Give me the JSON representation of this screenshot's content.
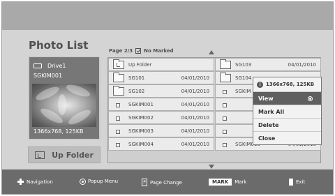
{
  "screen": {
    "title": "Photo List",
    "page_info": "Page 2/3",
    "mark_status": "No Marked"
  },
  "preview": {
    "drive_label": "Drive1",
    "file_name": "SGKIM001",
    "resolution": "1366x768, 125KB"
  },
  "up_folder_button": "Up Folder",
  "list_left": [
    {
      "type": "folder-up",
      "name": "Up Folder",
      "date": ""
    },
    {
      "type": "folder",
      "name": "SG101",
      "date": "04/01/2010"
    },
    {
      "type": "folder",
      "name": "SG102",
      "date": "04/01/2010"
    },
    {
      "type": "file",
      "name": "SGKIM001",
      "date": "04/01/2010"
    },
    {
      "type": "file",
      "name": "SGKIM002",
      "date": "04/01/2010"
    },
    {
      "type": "file",
      "name": "SGKIM003",
      "date": "04/01/2010"
    },
    {
      "type": "file",
      "name": "SGKIM004",
      "date": "04/01/2010"
    }
  ],
  "list_right": [
    {
      "type": "folder",
      "name": "SG103",
      "date": "04/01/2010"
    },
    {
      "type": "folder",
      "name": "SG104",
      "date": ""
    },
    {
      "type": "file",
      "name": "SGKIM",
      "date": ""
    },
    {
      "type": "file",
      "name": "",
      "date": ""
    },
    {
      "type": "file",
      "name": "",
      "date": ""
    },
    {
      "type": "file",
      "name": "",
      "date": ""
    },
    {
      "type": "file",
      "name": "SGKIM010",
      "date": "04/01/2010"
    }
  ],
  "popup": {
    "info": "1366x768, 125KB",
    "items": [
      "View",
      "Mark All",
      "Delete",
      "Close"
    ],
    "selected": "View"
  },
  "footer": {
    "navigation": "Navigation",
    "popup_menu": "Popup Menu",
    "page_change": "Page Change",
    "mark_key": "MARK",
    "mark": "Mark",
    "exit": "Exit"
  }
}
